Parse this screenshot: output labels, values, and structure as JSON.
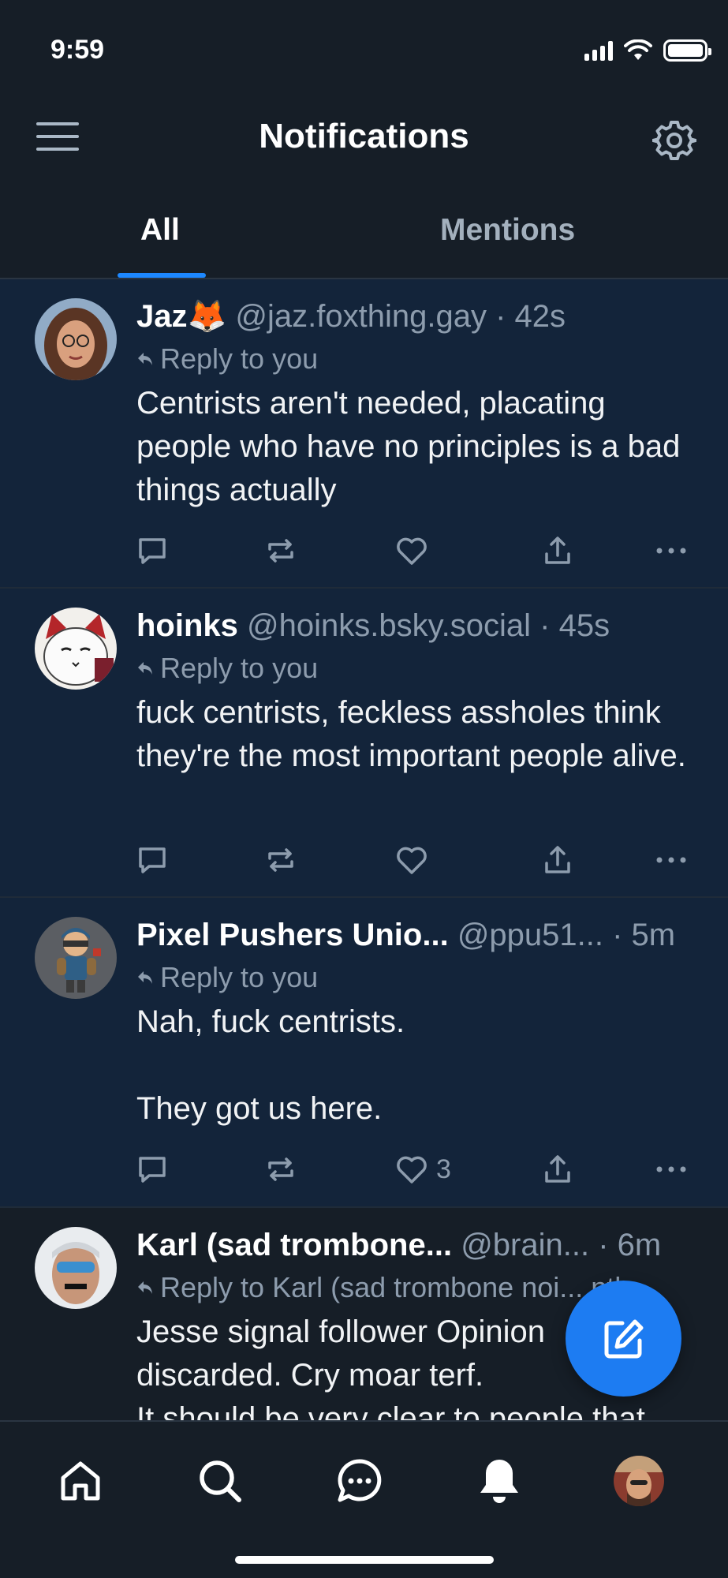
{
  "status_bar": {
    "time": "9:59"
  },
  "header": {
    "title": "Notifications"
  },
  "tabs": [
    {
      "label": "All",
      "active": true
    },
    {
      "label": "Mentions",
      "active": false
    }
  ],
  "notifications": [
    {
      "name": "Jaz🦊",
      "handle": "@jaz.foxthing.gay",
      "time": "· 42s",
      "reply_label": "Reply to you",
      "text": "Centrists aren't needed, placating people who have no principles is a bad things actually",
      "like_count": ""
    },
    {
      "name": "hoinks",
      "handle": "@hoinks.bsky.social",
      "time": "· 45s",
      "reply_label": "Reply to you",
      "text": "fuck centrists, feckless assholes think they're the most important people alive.",
      "like_count": ""
    },
    {
      "name": "Pixel Pushers Unio...",
      "handle": "@ppu51...",
      "time": "· 5m",
      "reply_label": "Reply to you",
      "text": "Nah, fuck centrists.\n\nThey got us here.",
      "like_count": "3"
    },
    {
      "name": "Karl (sad trombone...",
      "handle": "@brain...",
      "time": "· 6m",
      "reply_label": "Reply to Karl (sad trombone noi... nth...",
      "text": "Jesse signal follower Opinion discarded.  Cry moar terf.\nIt should be very clear to people that",
      "like_count": ""
    }
  ],
  "colors": {
    "accent": "#1d88ff",
    "fab": "#1d7cf2",
    "background": "#161e27",
    "unread_bg": "#13243a"
  },
  "icons": {
    "header": [
      "menu-icon",
      "gear-icon"
    ],
    "actions": [
      "reply-icon",
      "repost-icon",
      "heart-icon",
      "share-icon",
      "more-icon"
    ],
    "nav": [
      "home-icon",
      "search-icon",
      "chat-icon",
      "bell-icon",
      "avatar"
    ],
    "fab": "compose-icon"
  }
}
